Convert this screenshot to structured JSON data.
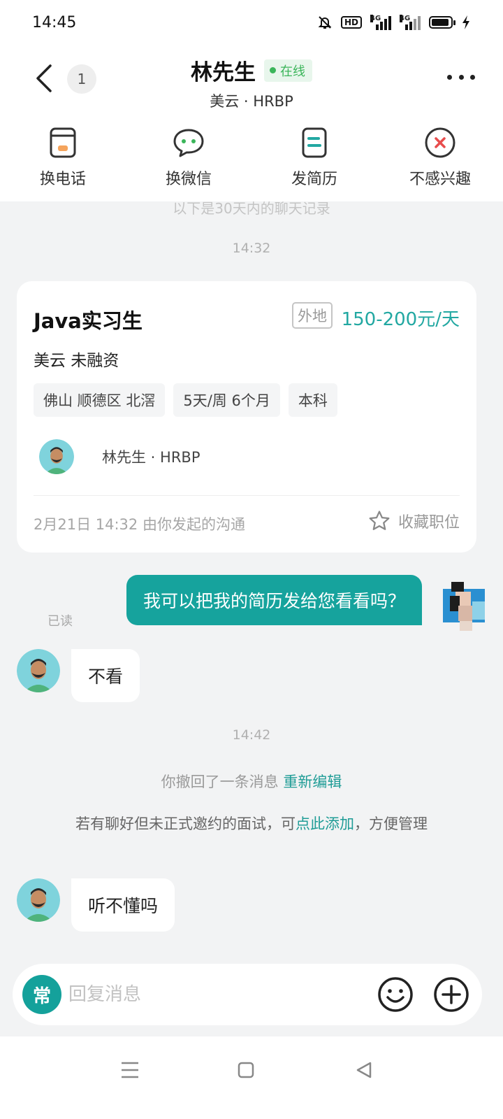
{
  "status_bar": {
    "time": "14:45",
    "hd_label": "HD",
    "signal1_label": "4G",
    "signal2_label": "4G"
  },
  "header": {
    "unread_count": "1",
    "contact_name": "林先生",
    "online_label": "在线",
    "contact_sub": "美云 · HRBP"
  },
  "actions": [
    {
      "label": "换电话",
      "icon": "phone-icon"
    },
    {
      "label": "换微信",
      "icon": "wechat-icon"
    },
    {
      "label": "发简历",
      "icon": "resume-icon"
    },
    {
      "label": "不感兴趣",
      "icon": "not-interested-icon"
    }
  ],
  "chat": {
    "history_note": "以下是30天内的聊天记录",
    "timestamp_1": "14:32",
    "job_card": {
      "title": "Java实习生",
      "remote_tag": "外地",
      "salary": "150-200元/天",
      "company": "美云  未融资",
      "tags": [
        "佛山 顺德区 北滘",
        "5天/周 6个月",
        "本科"
      ],
      "recruiter": "林先生 · HRBP",
      "footer": "2月21日 14:32 由你发起的沟通",
      "favorite_label": "收藏职位"
    },
    "outgoing_1": "我可以把我的简历发给您看看吗？",
    "read_label": "已读",
    "incoming_1": "不看",
    "timestamp_2": "14:42",
    "recall_text": "你撤回了一条消息",
    "recall_link": "重新编辑",
    "interview_note_pre": "若有聊好但未正式邀约的面试，可",
    "interview_note_link": "点此添加",
    "interview_note_post": "，方便管理",
    "incoming_2": "听不懂吗"
  },
  "input": {
    "common_label": "常",
    "placeholder": "回复消息"
  },
  "colors": {
    "accent": "#16a39d",
    "online": "#3bb55a",
    "background": "#f2f3f4"
  }
}
